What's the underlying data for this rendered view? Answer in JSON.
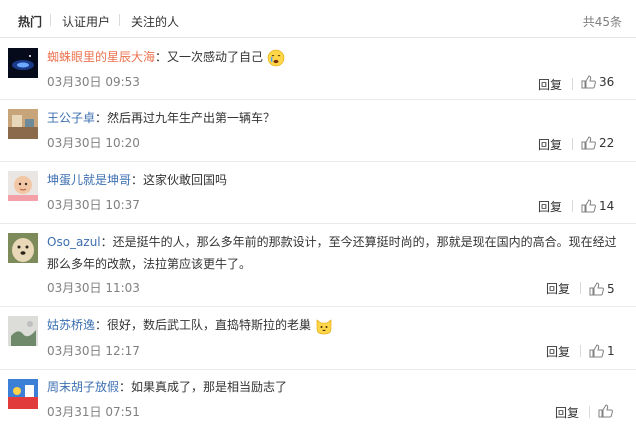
{
  "tabs": [
    "热门",
    "认证用户",
    "关注的人"
  ],
  "total": "共45条",
  "reply_label": "回复",
  "comments": [
    {
      "user": "蜘蛛眼里的星辰大海",
      "text": "：又一次感动了自己",
      "date": "03月30日 09:53",
      "likes": "36",
      "emoji": "crying-face-icon"
    },
    {
      "user": "王公子卓",
      "text": "：然后再过九年生产出第一辆车？",
      "date": "03月30日 10:20",
      "likes": "22"
    },
    {
      "user": "坤蛋儿就是坤哥",
      "text": "：这家伙敢回国吗",
      "date": "03月30日 10:37",
      "likes": "14"
    },
    {
      "user": "Oso_azul",
      "text": "：还是挺牛的人，那么多年前的那款设计，至今还算挺时尚的，那就是现在国内的高合。现在经过那么多年的改款，法拉第应该更牛了。",
      "date": "03月30日 11:03",
      "likes": "5"
    },
    {
      "user": "姑苏桥逸",
      "text": "：很好，数后武工队，直捣特斯拉的老巢",
      "date": "03月30日 12:17",
      "likes": "1",
      "emoji": "cat-face-icon"
    },
    {
      "user": "周末胡子放假",
      "text": "：如果真成了，那是相当励志了",
      "date": "03月31日 07:51",
      "likes": ""
    }
  ]
}
